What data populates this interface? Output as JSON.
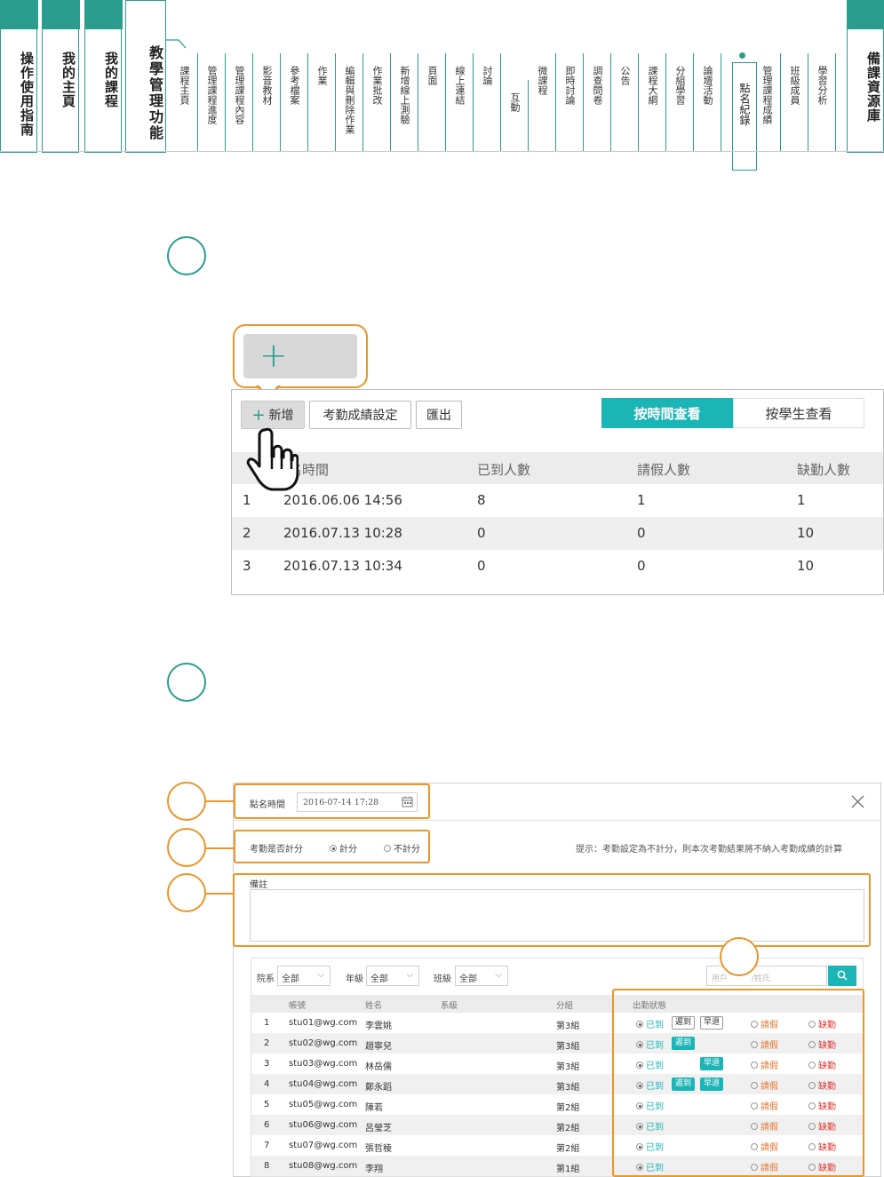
{
  "nav": {
    "main_tabs": [
      {
        "label": "操作使用指南"
      },
      {
        "label": "我的主頁"
      },
      {
        "label": "我的課程"
      },
      {
        "label": "教學管理功能"
      },
      {
        "label": "備課資源庫"
      }
    ],
    "sub_tabs": [
      "課程主頁",
      "管理課程進度",
      "管理課程內容",
      "影音教材",
      "參考檔案",
      "作業",
      "編輯與刪除作業",
      "作業批改",
      "新增線上測驗",
      "頁面",
      "線上連結",
      "討論",
      "互動",
      "微課程",
      "即時討論",
      "調查問卷",
      "公告",
      "課程大綱",
      "分組學習",
      "論壇活動",
      "點名紀錄",
      "管理課程成績",
      "班級成員",
      "學習分析"
    ],
    "active_sub_tab": "點名紀錄",
    "accent_color": "#2a9d8f"
  },
  "section1": {
    "toolbar": {
      "add_label": "新增",
      "grade_settings_label": "考勤成績設定",
      "export_label": "匯出"
    },
    "view_toggle": {
      "by_time_label": "按時間查看",
      "by_student_label": "按學生查看"
    },
    "table": {
      "columns": [
        "名時間",
        "已到人數",
        "請假人數",
        "缺勤人數"
      ],
      "rows": [
        {
          "no": "1",
          "time": "2016.06.06 14:56",
          "present": "8",
          "leave": "1",
          "absent": "1"
        },
        {
          "no": "2",
          "time": "2016.07.13 10:28",
          "present": "0",
          "leave": "0",
          "absent": "10"
        },
        {
          "no": "3",
          "time": "2016.07.13 10:34",
          "present": "0",
          "leave": "0",
          "absent": "10"
        }
      ]
    }
  },
  "section2": {
    "roll_time_label": "點名時間",
    "roll_time_value": "2016-07-14 17:28",
    "count_label": "考勤是否計分",
    "count_option": "計分",
    "nocount_option": "不計分",
    "hint": "提示：考勤設定為不計分，則本次考勤結果將不納入考勤成績的計算",
    "remark_label": "備註",
    "filters": {
      "dept_label": "院系",
      "dept_value": "全部",
      "grade_label": "年級",
      "grade_value": "全部",
      "class_label": "班級",
      "class_value": "全部",
      "search_placeholder_a": "用戶",
      "search_placeholder_b": "/姓氏"
    },
    "table": {
      "columns": [
        "帳號",
        "姓名",
        "系級",
        "分組",
        "出勤狀態"
      ],
      "status_labels": {
        "present": "已到",
        "late": "遲到",
        "early": "早退",
        "leave": "請假",
        "absent": "缺勤"
      },
      "rows": [
        {
          "no": "1",
          "account": "stu01@wg.com",
          "name": "李雲姚",
          "group": "第3組",
          "late_chip": "遲到",
          "early_chip": "早退",
          "late_on": false,
          "early_on": false
        },
        {
          "no": "2",
          "account": "stu02@wg.com",
          "name": "趙寧兒",
          "group": "第3組",
          "late_chip": "遲到",
          "early_chip": "",
          "late_on": true,
          "early_on": false
        },
        {
          "no": "3",
          "account": "stu03@wg.com",
          "name": "林岳儒",
          "group": "第3組",
          "late_chip": "",
          "early_chip": "早退",
          "late_on": false,
          "early_on": true
        },
        {
          "no": "4",
          "account": "stu04@wg.com",
          "name": "鄭永蹈",
          "group": "第3組",
          "late_chip": "遲到",
          "early_chip": "早退",
          "late_on": true,
          "early_on": true
        },
        {
          "no": "5",
          "account": "stu05@wg.com",
          "name": "陳若",
          "group": "第2組",
          "late_chip": "",
          "early_chip": "",
          "late_on": false,
          "early_on": false
        },
        {
          "no": "6",
          "account": "stu06@wg.com",
          "name": "呂瑩芝",
          "group": "第2組",
          "late_chip": "",
          "early_chip": "",
          "late_on": false,
          "early_on": false
        },
        {
          "no": "7",
          "account": "stu07@wg.com",
          "name": "張哲稜",
          "group": "第2組",
          "late_chip": "",
          "early_chip": "",
          "late_on": false,
          "early_on": false
        },
        {
          "no": "8",
          "account": "stu08@wg.com",
          "name": "李翔",
          "group": "第1組",
          "late_chip": "",
          "early_chip": "",
          "late_on": false,
          "early_on": false
        }
      ]
    }
  }
}
